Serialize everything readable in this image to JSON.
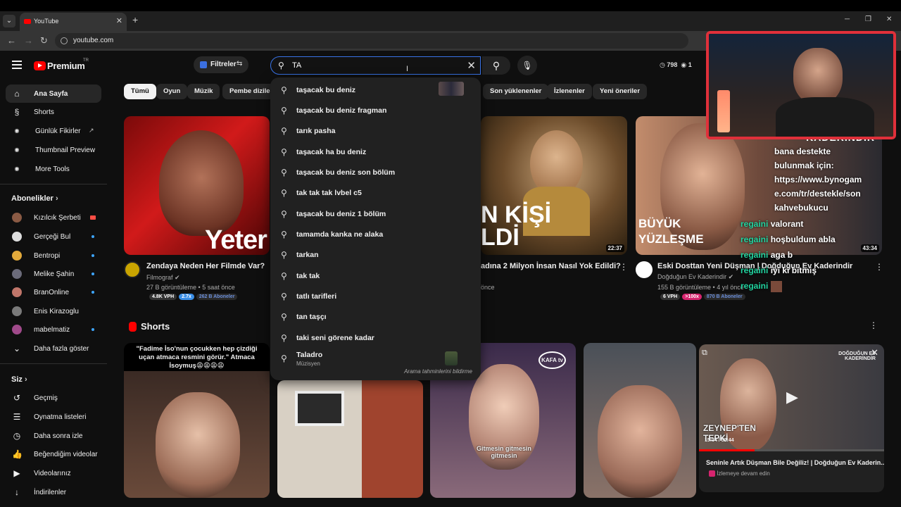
{
  "browser": {
    "tab_title": "YouTube",
    "url": "youtube.com"
  },
  "masthead": {
    "logo_text": "Premium",
    "country_code": "TR",
    "filter_label": "Filtreler",
    "search_value": "TA",
    "stats": {
      "views": "798",
      "count": "1"
    }
  },
  "sidebar": {
    "top": [
      {
        "label": "Ana Sayfa",
        "icon": "home-icon"
      },
      {
        "label": "Shorts",
        "icon": "shorts-icon"
      },
      {
        "label": "Günlük Fikirler",
        "icon": "extension-icon"
      },
      {
        "label": "Thumbnail Preview",
        "icon": "extension-icon"
      },
      {
        "label": "More Tools",
        "icon": "extension-icon"
      }
    ],
    "subscriptions_title": "Abonelikler",
    "subscriptions": [
      {
        "label": "Kızılcık Şerbeti",
        "color": "#8a5a44"
      },
      {
        "label": "Gerçeği Bul",
        "color": "#ddd"
      },
      {
        "label": "Bentropi",
        "color": "#e2a93b"
      },
      {
        "label": "Melike Şahin",
        "color": "#6b6b7a"
      },
      {
        "label": "BranOnline",
        "color": "#c0766a"
      },
      {
        "label": "Enis Kirazoglu",
        "color": "#7a7a7a"
      },
      {
        "label": "mabelmatiz",
        "color": "#a04a8a"
      }
    ],
    "show_more": "Daha fazla göster",
    "you_title": "Siz",
    "you_items": [
      {
        "label": "Geçmiş",
        "icon": "history-icon"
      },
      {
        "label": "Oynatma listeleri",
        "icon": "playlist-icon"
      },
      {
        "label": "Daha sonra izle",
        "icon": "clock-icon"
      },
      {
        "label": "Beğendiğim videolar",
        "icon": "thumbs-up-icon"
      },
      {
        "label": "Videolarınız",
        "icon": "video-icon"
      },
      {
        "label": "İndirilenler",
        "icon": "download-icon"
      }
    ]
  },
  "chips": [
    "Tümü",
    "Oyun",
    "Müzik",
    "Pembe diziler",
    "Son yüklenenler",
    "İzlenenler",
    "Yeni öneriler"
  ],
  "videos": [
    {
      "title": "Zendaya Neden Her Filmde Var?",
      "channel": "Filmograf",
      "meta": "27 B görüntüleme • 5 saat önce",
      "badges": [
        "4.8K VPH",
        "2.7x",
        "262 B Aboneler"
      ],
      "overlay": "Yeter"
    },
    {
      "title": "adına 2 Milyon İnsan Nasıl Yok Edildi?",
      "meta": "önce",
      "duration": "22:37",
      "overlay": "N KİŞİ LDİ"
    },
    {
      "title": "Eski Dosttan Yeni Düşman | Doğduğun Ev Kaderindir",
      "channel": "Doğduğun Ev Kaderindir",
      "meta": "155 B görüntüleme • 4 yıl önce",
      "badges": [
        "6 VPH",
        ">100x",
        "870 B Aboneler"
      ],
      "duration": "43:34",
      "overlay_top": "KADERİNDİR",
      "overlay_main": "BÜYÜK YÜZLEŞME"
    }
  ],
  "chat_overlay": {
    "lines": [
      "bana destekte",
      "bulunmak için:",
      "https://www.bynogam",
      "e.com/tr/destekle/son",
      "kahvebukucu"
    ],
    "messages": [
      {
        "user": "regaini",
        "text": "valorant"
      },
      {
        "user": "regaini",
        "text": "hoşbuldum abla"
      },
      {
        "user": "regaini",
        "text": "aga b"
      },
      {
        "user": "regaini",
        "text": "iyi ki bitmiş"
      },
      {
        "user": "regaini",
        "text": ""
      }
    ]
  },
  "shorts": {
    "title": "Shorts",
    "items": [
      {
        "caption": "\"Fadime İso'nun çocukken hep çizdiği uçan atmaca resmini görür.\" Atmaca İsoymuş😩😩😩😩"
      },
      {
        "caption": ""
      },
      {
        "caption": "Gitmesin gitmesin gitmesin",
        "logo": "KAFA tv"
      },
      {
        "caption": ""
      }
    ]
  },
  "search_suggestions": [
    {
      "text": "taşacak bu deniz",
      "has_thumb": true
    },
    {
      "text": "taşacak bu deniz fragman"
    },
    {
      "text": "tarık pasha"
    },
    {
      "text": "taşacak ha bu deniz"
    },
    {
      "text": "taşacak bu deniz son bölüm"
    },
    {
      "text": "tak tak tak lvbel c5"
    },
    {
      "text": "taşacak bu deniz 1 bölüm"
    },
    {
      "text": "tamamda kanka ne alaka"
    },
    {
      "text": "tarkan"
    },
    {
      "text": "tak tak"
    },
    {
      "text": "tatlı tarifleri"
    },
    {
      "text": "tan taşçı"
    },
    {
      "text": "taki seni görene kadar"
    },
    {
      "text": "Taladro",
      "sub": "Müzisyen",
      "has_thumb": true
    }
  ],
  "search_report": "Arama tahminlerini bildirme",
  "miniplayer": {
    "title": "Seninle Artık Düşman Bile Değiliz! | Doğduğun Ev Kaderin...",
    "subtitle": "İzlemeye devam edin",
    "time": "15:34 / 52:44",
    "overlay_top": "DOĞDUĞUN EV KADERİNDİR",
    "overlay_main": "ZEYNEP'TEN TEPKİ",
    "progress": 0.3
  },
  "colors": {
    "accent": "#ff0000",
    "search_focus": "#3873e8",
    "chat_user": "#21d4a0"
  }
}
